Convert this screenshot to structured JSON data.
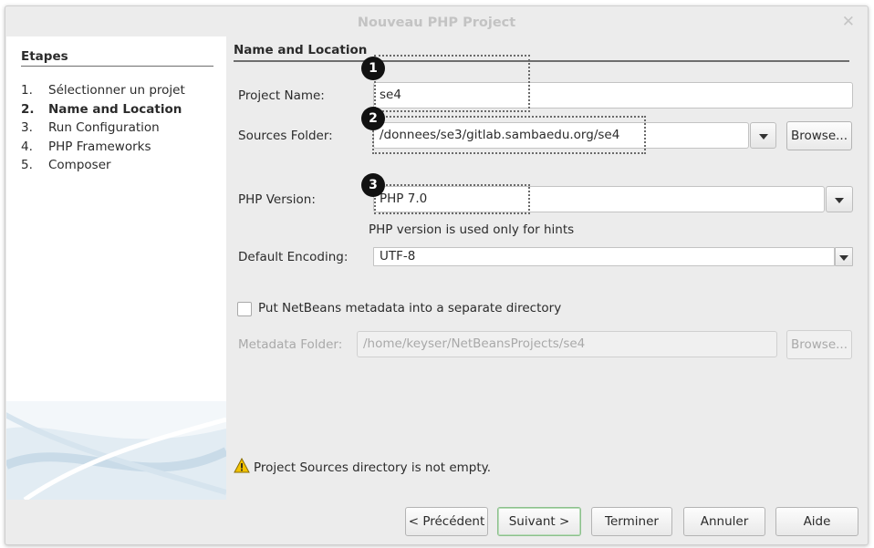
{
  "window": {
    "title": "Nouveau PHP Project",
    "close_glyph": "✕"
  },
  "steps": {
    "title": "Etapes",
    "items": [
      {
        "num": "1.",
        "label": "Sélectionner un projet",
        "active": false
      },
      {
        "num": "2.",
        "label": "Name and Location",
        "active": true
      },
      {
        "num": "3.",
        "label": "Run Configuration",
        "active": false
      },
      {
        "num": "4.",
        "label": "PHP Frameworks",
        "active": false
      },
      {
        "num": "5.",
        "label": "Composer",
        "active": false
      }
    ]
  },
  "section": {
    "title": "Name and Location"
  },
  "project_name": {
    "label": "Project Name:",
    "value": "se4"
  },
  "sources_folder": {
    "label": "Sources Folder:",
    "value": "/donnees/se3/gitlab.sambaedu.org/se4",
    "browse_label": "Browse..."
  },
  "php_version": {
    "label": "PHP Version:",
    "value": "PHP 7.0",
    "hint": "PHP version is used only for hints"
  },
  "encoding": {
    "label": "Default Encoding:",
    "value": "UTF-8"
  },
  "metadata": {
    "checkbox_label": "Put NetBeans metadata into a separate directory",
    "checked": false,
    "folder_label": "Metadata Folder:",
    "folder_value": "/home/keyser/NetBeansProjects/se4",
    "browse_label": "Browse..."
  },
  "warning": {
    "text": "Project Sources directory is not empty.",
    "icon": "warning-icon"
  },
  "buttons": {
    "previous": "< Précédent",
    "next": "Suivant >",
    "finish": "Terminer",
    "cancel": "Annuler",
    "help": "Aide"
  },
  "callouts": [
    "1",
    "2",
    "3"
  ],
  "colors": {
    "window_bg": "#ececec",
    "title_text": "#c3c3c3",
    "focus_border": "#8cc08c",
    "callout_bg": "#111111"
  }
}
